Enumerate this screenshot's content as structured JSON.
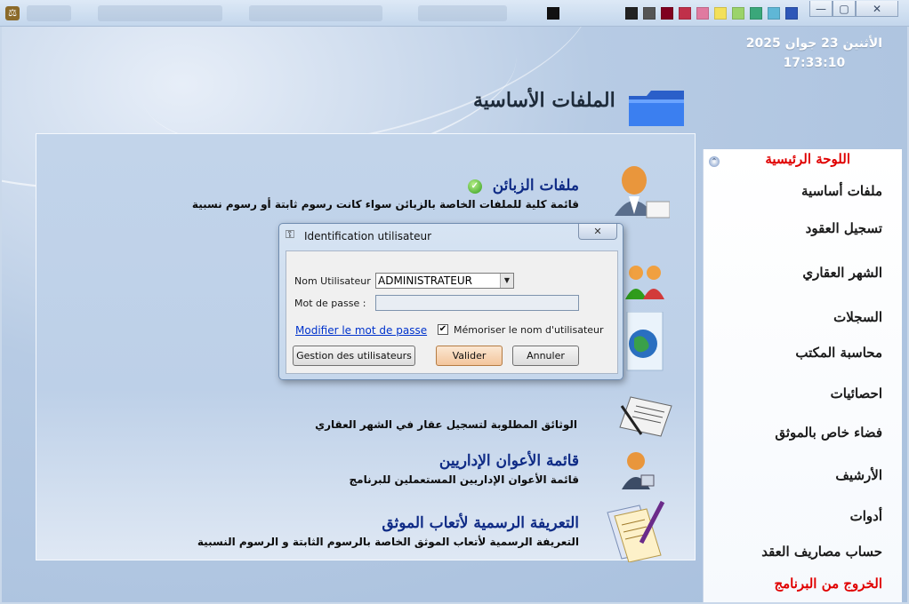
{
  "window": {
    "app_icon_glyph": "⚖",
    "controls": {
      "minimize": "—",
      "maximize": "▢",
      "close": "✕"
    }
  },
  "header": {
    "date": "الأثنين 23 جوان 2025",
    "time": "17:33:10",
    "page_title": "الملفات الأساسية"
  },
  "items": [
    {
      "heading": "ملفات الزبائن",
      "desc": "قائمة كلية للملفات الخاصة بالزبائن سواء كانت رسوم ثابتة أو رسوم نسبية",
      "icon": "client-person-icon",
      "bullet": "✓"
    },
    {
      "heading": "",
      "desc": "الوثائق المطلوبة لتسجيل عقار في الشهر العقاري",
      "icon": "document-pen-icon"
    },
    {
      "heading": "قائمة الأعوان الإداريين",
      "desc": "قائمة الأعوان الإداريين المستعملين للبرنامج",
      "icon": "admin-user-icon"
    },
    {
      "heading": "التعريفة الرسمية لأتعاب الموثق",
      "desc": "التعريفة الرسمية لأتعاب الموثق   الخاصة بالرسوم الثابتة و الرسوم النسبية",
      "icon": "tariff-paper-icon"
    }
  ],
  "sidebar": {
    "collapse_glyph": "⌃",
    "items": [
      {
        "label": "اللوحة الرئيسية",
        "red": true
      },
      {
        "label": "ملفات أساسية"
      },
      {
        "label": "تسجيل العقود"
      },
      {
        "label": "الشهر العقاري"
      },
      {
        "label": "السجلات"
      },
      {
        "label": "محاسبة المكتب"
      },
      {
        "label": "احصائيات"
      },
      {
        "label": "فضاء خاص بالموثق"
      },
      {
        "label": "الأرشيف"
      },
      {
        "label": "أدوات"
      },
      {
        "label": "حساب مصاريف العقد"
      },
      {
        "label": "الخروج من البرنامج",
        "red": true
      }
    ]
  },
  "dialog": {
    "title": "Identification utilisateur",
    "close_glyph": "✕",
    "username_label": "Nom Utilisateur",
    "username_value": "ADMINISTRATEUR",
    "password_label": "Mot de passe :",
    "change_password_link": "Modifier le mot de passe",
    "remember_label": "Mémoriser le nom d'utilisateur",
    "remember_checked": "✔",
    "btn_users": "Gestion des utilisateurs",
    "btn_ok": "Valider",
    "btn_cancel": "Annuler"
  },
  "colors": {
    "heading": "#0f2b86",
    "sidebar_red": "#e00000",
    "link": "#0033cc"
  }
}
